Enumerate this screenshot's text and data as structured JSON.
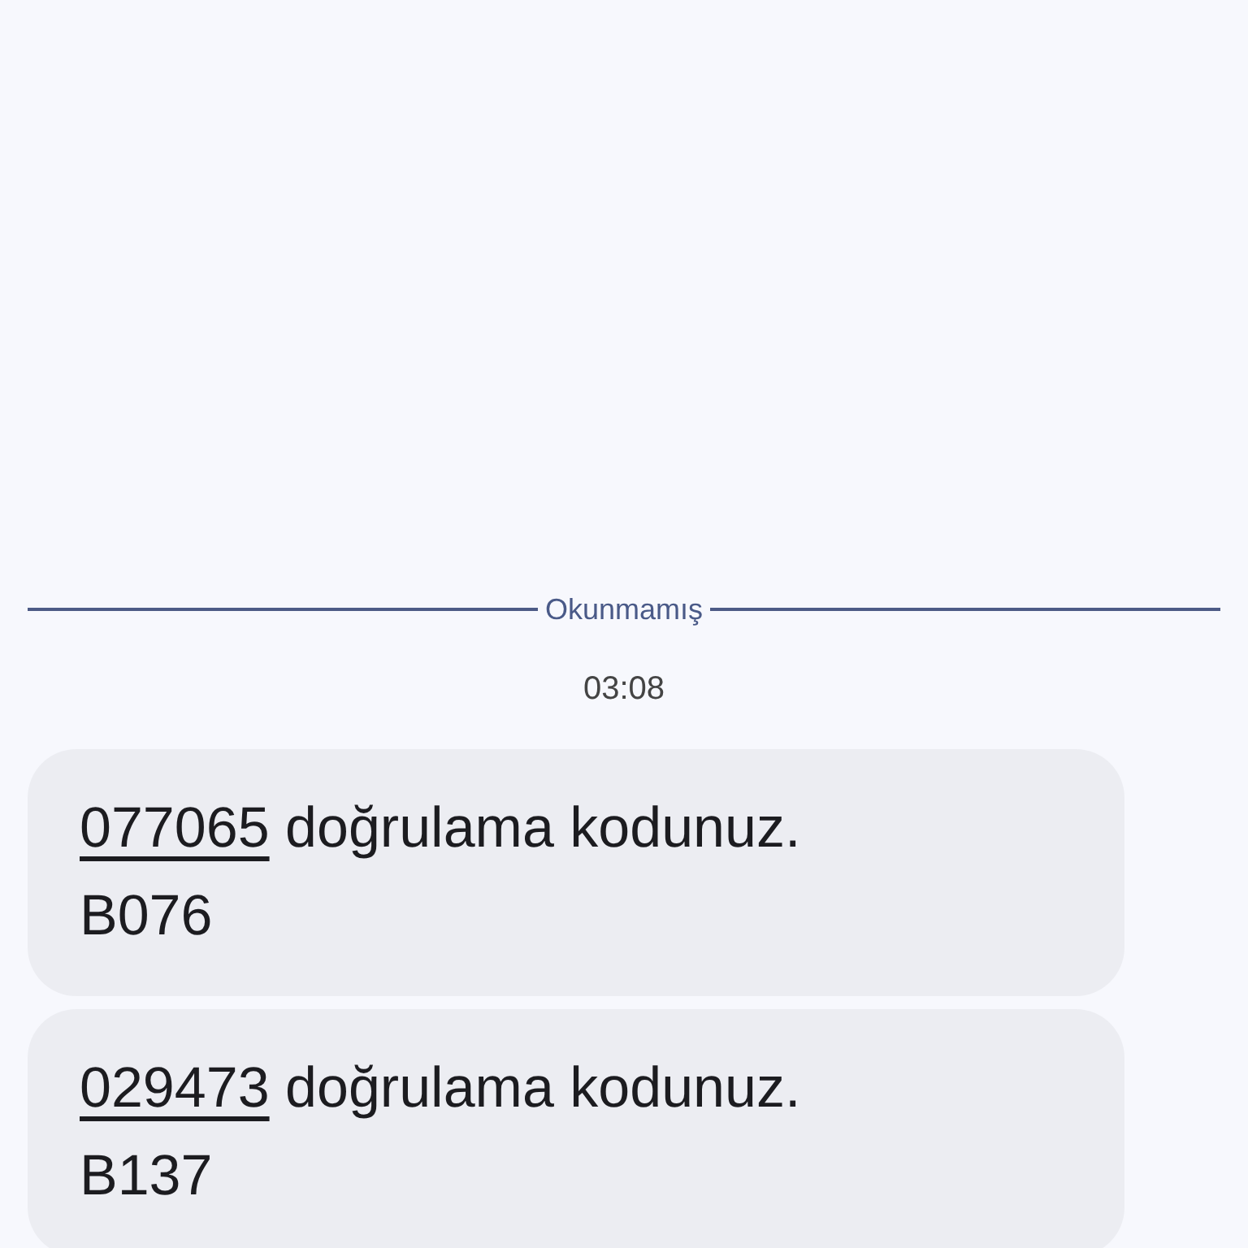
{
  "divider": {
    "label": "Okunmamış"
  },
  "timestamp": "03:08",
  "messages": [
    {
      "code": "077065",
      "text": "doğrulama kodunuz.",
      "footer": "B076"
    },
    {
      "code": "029473",
      "text": "doğrulama kodunuz.",
      "footer": "B137"
    }
  ]
}
